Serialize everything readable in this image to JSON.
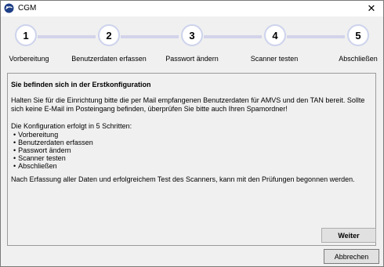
{
  "window": {
    "title": "CGM",
    "close_symbol": "✕"
  },
  "steps": [
    {
      "number": "1",
      "label": "Vorbereitung"
    },
    {
      "number": "2",
      "label": "Benutzerdaten erfassen"
    },
    {
      "number": "3",
      "label": "Passwort ändern"
    },
    {
      "number": "4",
      "label": "Scanner testen"
    },
    {
      "number": "5",
      "label": "Abschließen"
    }
  ],
  "content": {
    "title": "Sie befinden sich in der Erstkonfiguration",
    "paragraph": "Halten Sie für die Einrichtung bitte die per Mail empfangenen Benutzerdaten für AMVS und den TAN bereit. Sollte sich keine E-Mail im Posteingang befinden, überprüfen Sie bitte auch Ihren Spamordner!",
    "steps_intro": "Die Konfiguration erfolgt in 5 Schritten:",
    "steps_list": [
      "Vorbereitung",
      "Benutzerdaten erfassen",
      "Passwort ändern",
      "Scanner testen",
      "Abschließen"
    ],
    "final_note": "Nach Erfassung aller Daten und erfolgreichem Test des Scanners, kann mit den Prüfungen begonnen werden."
  },
  "buttons": {
    "next": "Weiter",
    "cancel": "Abbrechen"
  },
  "colors": {
    "step_line": "#d3d3ea",
    "step_border": "#cdd3ec"
  }
}
